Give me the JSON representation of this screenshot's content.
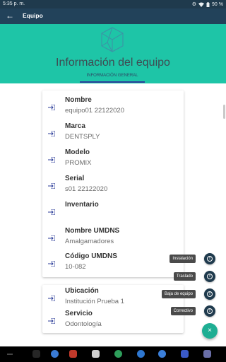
{
  "status_bar": {
    "time": "5:35 p. m.",
    "battery": "90 %"
  },
  "app_bar": {
    "back_icon": "arrow-left-icon",
    "title": "Equipo"
  },
  "header": {
    "logo_icon": "polyhedron-logo-icon",
    "heading": "Información del equipo",
    "tab_label": "INFORMACIÓN GENERAL"
  },
  "fields": [
    {
      "label": "Nombre",
      "value": "equipo01 22122020"
    },
    {
      "label": "Marca",
      "value": "DENTSPLY"
    },
    {
      "label": "Modelo",
      "value": "PROMIX"
    },
    {
      "label": "Serial",
      "value": "s01 22122020"
    },
    {
      "label": "Inventario",
      "value": ""
    },
    {
      "label": "Nombre UMDNS",
      "value": "Amalgamadores"
    },
    {
      "label": "Código UMDNS",
      "value": "10-082"
    },
    {
      "label": "Ubicación",
      "value": "Institución Prueba 1"
    },
    {
      "label": "Servicio",
      "value": "Odontología"
    }
  ],
  "actions": [
    {
      "label": "Instalación",
      "icon": "info-icon"
    },
    {
      "label": "Traslado",
      "icon": "info-icon"
    },
    {
      "label": "Baja de equipo",
      "icon": "info-icon"
    },
    {
      "label": "Correctivo",
      "icon": "info-icon"
    }
  ],
  "fab": {
    "icon": "close-icon",
    "glyph": "×"
  },
  "colors": {
    "status_bar": "#1f3a4d",
    "app_bar": "#22425a",
    "header": "#1ec5a7",
    "fab": "#1eae93",
    "field_icon": "#2c3e9a"
  }
}
